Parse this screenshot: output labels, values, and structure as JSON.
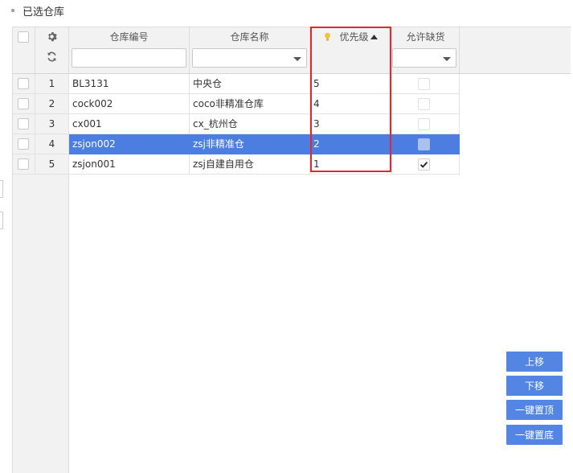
{
  "section_title": "已选仓库",
  "columns": {
    "code": "仓库编号",
    "name": "仓库名称",
    "priority": "优先级",
    "allow_shortage": "允许缺货"
  },
  "icons": {
    "settings": "gear-icon",
    "refresh": "refresh-icon",
    "hint": "lightbulb-icon",
    "sort": "sort-asc-icon"
  },
  "filters": {
    "code_value": "",
    "name_value": "",
    "allow_shortage_value": ""
  },
  "rows": [
    {
      "index": "1",
      "code": "BL3131",
      "name": "中央仓",
      "priority": "5",
      "allow_shortage": false,
      "selected": false
    },
    {
      "index": "2",
      "code": "cock002",
      "name": "coco非精准仓库",
      "priority": "4",
      "allow_shortage": false,
      "selected": false
    },
    {
      "index": "3",
      "code": "cx001",
      "name": "cx_杭州仓",
      "priority": "3",
      "allow_shortage": false,
      "selected": false
    },
    {
      "index": "4",
      "code": "zsjon002",
      "name": "zsj非精准仓",
      "priority": "2",
      "allow_shortage": false,
      "selected": true
    },
    {
      "index": "5",
      "code": "zsjon001",
      "name": "zsj自建自用仓",
      "priority": "1",
      "allow_shortage": true,
      "selected": false
    }
  ],
  "buttons": {
    "move_up": "上移",
    "move_down": "下移",
    "to_top": "一键置顶",
    "to_bottom": "一键置底"
  },
  "colors": {
    "selected_row": "#4b7ee0",
    "button": "#5285e4",
    "highlight_box": "#e0282e"
  }
}
